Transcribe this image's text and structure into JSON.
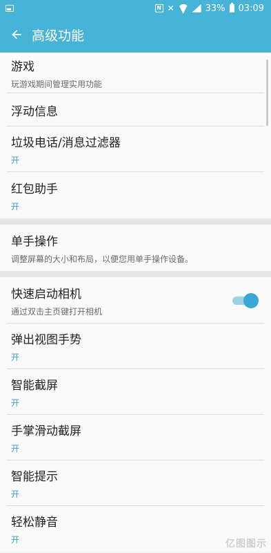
{
  "status_bar": {
    "battery_percent": "33%",
    "time": "03:09"
  },
  "app_bar": {
    "title": "高级功能"
  },
  "items": [
    {
      "title": "游戏",
      "subtitle": "玩游戏期间管理实用功能"
    },
    {
      "title": "浮动信息"
    },
    {
      "title": "垃圾电话/消息过滤器",
      "subtitle": "开"
    },
    {
      "title": "红包助手",
      "subtitle": "开"
    },
    {
      "title": "单手操作",
      "subtitle": "调整屏幕的大小和布局，以便您用单手操作设备。"
    },
    {
      "title": "快速启动相机",
      "subtitle": "通过双击主页键打开相机",
      "toggle_on": true
    },
    {
      "title": "弹出视图手势",
      "subtitle": "开"
    },
    {
      "title": "智能截屏",
      "subtitle": "开"
    },
    {
      "title": "手掌滑动截屏",
      "subtitle": "开"
    },
    {
      "title": "智能提示",
      "subtitle": "开"
    },
    {
      "title": "轻松静音",
      "subtitle": "开"
    }
  ],
  "watermark": "亿图图示",
  "colors": {
    "accent": "#47b3d6",
    "toggle_thumb": "#3aa8d6",
    "on_text": "#3aa0c6"
  }
}
